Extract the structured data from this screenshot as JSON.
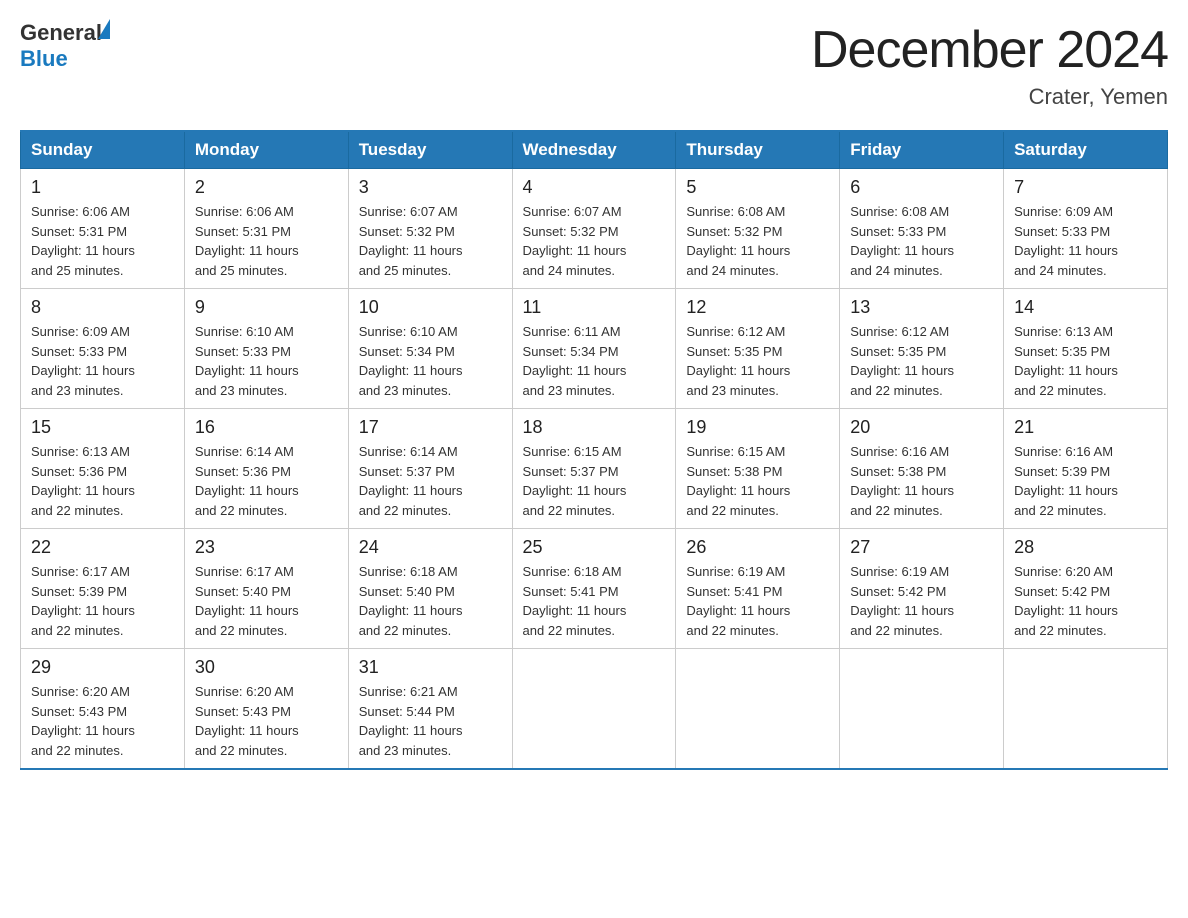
{
  "header": {
    "logo_general": "General",
    "logo_blue": "Blue",
    "title": "December 2024",
    "location": "Crater, Yemen"
  },
  "days_of_week": [
    "Sunday",
    "Monday",
    "Tuesday",
    "Wednesday",
    "Thursday",
    "Friday",
    "Saturday"
  ],
  "weeks": [
    [
      {
        "day": "1",
        "sunrise": "6:06 AM",
        "sunset": "5:31 PM",
        "daylight": "11 hours and 25 minutes."
      },
      {
        "day": "2",
        "sunrise": "6:06 AM",
        "sunset": "5:31 PM",
        "daylight": "11 hours and 25 minutes."
      },
      {
        "day": "3",
        "sunrise": "6:07 AM",
        "sunset": "5:32 PM",
        "daylight": "11 hours and 25 minutes."
      },
      {
        "day": "4",
        "sunrise": "6:07 AM",
        "sunset": "5:32 PM",
        "daylight": "11 hours and 24 minutes."
      },
      {
        "day": "5",
        "sunrise": "6:08 AM",
        "sunset": "5:32 PM",
        "daylight": "11 hours and 24 minutes."
      },
      {
        "day": "6",
        "sunrise": "6:08 AM",
        "sunset": "5:33 PM",
        "daylight": "11 hours and 24 minutes."
      },
      {
        "day": "7",
        "sunrise": "6:09 AM",
        "sunset": "5:33 PM",
        "daylight": "11 hours and 24 minutes."
      }
    ],
    [
      {
        "day": "8",
        "sunrise": "6:09 AM",
        "sunset": "5:33 PM",
        "daylight": "11 hours and 23 minutes."
      },
      {
        "day": "9",
        "sunrise": "6:10 AM",
        "sunset": "5:33 PM",
        "daylight": "11 hours and 23 minutes."
      },
      {
        "day": "10",
        "sunrise": "6:10 AM",
        "sunset": "5:34 PM",
        "daylight": "11 hours and 23 minutes."
      },
      {
        "day": "11",
        "sunrise": "6:11 AM",
        "sunset": "5:34 PM",
        "daylight": "11 hours and 23 minutes."
      },
      {
        "day": "12",
        "sunrise": "6:12 AM",
        "sunset": "5:35 PM",
        "daylight": "11 hours and 23 minutes."
      },
      {
        "day": "13",
        "sunrise": "6:12 AM",
        "sunset": "5:35 PM",
        "daylight": "11 hours and 22 minutes."
      },
      {
        "day": "14",
        "sunrise": "6:13 AM",
        "sunset": "5:35 PM",
        "daylight": "11 hours and 22 minutes."
      }
    ],
    [
      {
        "day": "15",
        "sunrise": "6:13 AM",
        "sunset": "5:36 PM",
        "daylight": "11 hours and 22 minutes."
      },
      {
        "day": "16",
        "sunrise": "6:14 AM",
        "sunset": "5:36 PM",
        "daylight": "11 hours and 22 minutes."
      },
      {
        "day": "17",
        "sunrise": "6:14 AM",
        "sunset": "5:37 PM",
        "daylight": "11 hours and 22 minutes."
      },
      {
        "day": "18",
        "sunrise": "6:15 AM",
        "sunset": "5:37 PM",
        "daylight": "11 hours and 22 minutes."
      },
      {
        "day": "19",
        "sunrise": "6:15 AM",
        "sunset": "5:38 PM",
        "daylight": "11 hours and 22 minutes."
      },
      {
        "day": "20",
        "sunrise": "6:16 AM",
        "sunset": "5:38 PM",
        "daylight": "11 hours and 22 minutes."
      },
      {
        "day": "21",
        "sunrise": "6:16 AM",
        "sunset": "5:39 PM",
        "daylight": "11 hours and 22 minutes."
      }
    ],
    [
      {
        "day": "22",
        "sunrise": "6:17 AM",
        "sunset": "5:39 PM",
        "daylight": "11 hours and 22 minutes."
      },
      {
        "day": "23",
        "sunrise": "6:17 AM",
        "sunset": "5:40 PM",
        "daylight": "11 hours and 22 minutes."
      },
      {
        "day": "24",
        "sunrise": "6:18 AM",
        "sunset": "5:40 PM",
        "daylight": "11 hours and 22 minutes."
      },
      {
        "day": "25",
        "sunrise": "6:18 AM",
        "sunset": "5:41 PM",
        "daylight": "11 hours and 22 minutes."
      },
      {
        "day": "26",
        "sunrise": "6:19 AM",
        "sunset": "5:41 PM",
        "daylight": "11 hours and 22 minutes."
      },
      {
        "day": "27",
        "sunrise": "6:19 AM",
        "sunset": "5:42 PM",
        "daylight": "11 hours and 22 minutes."
      },
      {
        "day": "28",
        "sunrise": "6:20 AM",
        "sunset": "5:42 PM",
        "daylight": "11 hours and 22 minutes."
      }
    ],
    [
      {
        "day": "29",
        "sunrise": "6:20 AM",
        "sunset": "5:43 PM",
        "daylight": "11 hours and 22 minutes."
      },
      {
        "day": "30",
        "sunrise": "6:20 AM",
        "sunset": "5:43 PM",
        "daylight": "11 hours and 22 minutes."
      },
      {
        "day": "31",
        "sunrise": "6:21 AM",
        "sunset": "5:44 PM",
        "daylight": "11 hours and 23 minutes."
      },
      null,
      null,
      null,
      null
    ]
  ],
  "labels": {
    "sunrise": "Sunrise:",
    "sunset": "Sunset:",
    "daylight": "Daylight:"
  }
}
